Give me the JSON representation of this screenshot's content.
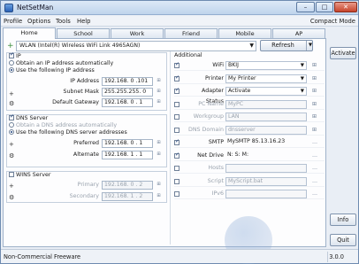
{
  "window": {
    "title": "NetSetMan"
  },
  "menu": {
    "items": [
      "Profile",
      "Options",
      "Tools",
      "Help"
    ],
    "compact_mode": "Compact Mode"
  },
  "tabs": [
    "Home",
    "School",
    "Work",
    "Friend",
    "Mobile",
    "AP"
  ],
  "adapter": {
    "value": "WLAN (Intel(R) Wireless WiFi Link 4965AGN)",
    "refresh_label": "Refresh"
  },
  "ip": {
    "group_label": "IP",
    "option_auto": "Obtain an IP address automatically",
    "option_manual": "Use the following IP address",
    "ip_label": "IP Address",
    "ip_value": "192.168. 0 .101",
    "mask_label": "Subnet Mask",
    "mask_value": "255.255.255. 0",
    "gateway_label": "Default Gateway",
    "gateway_value": "192.168. 0 . 1"
  },
  "dns": {
    "group_label": "DNS Server",
    "option_auto": "Obtain a DNS address automatically",
    "option_manual": "Use the following DNS server addresses",
    "preferred_label": "Preferred",
    "preferred_value": "192.168. 0 . 1",
    "alternate_label": "Alternate",
    "alternate_value": "192.168. 1 . 1"
  },
  "wins": {
    "group_label": "WINS Server",
    "primary_label": "Primary",
    "primary_value": "192.168. 0 . 2",
    "secondary_label": "Secondary",
    "secondary_value": "192.168. 1 . 2"
  },
  "additional": {
    "label": "Additional",
    "rows": [
      {
        "label": "WiFi",
        "value": "BKIJ",
        "checked": true,
        "enabled": true
      },
      {
        "label": "Printer",
        "value": "My Printer",
        "checked": true,
        "enabled": true
      },
      {
        "label": "Adapter Status",
        "value": "Activate",
        "checked": true,
        "enabled": true
      },
      {
        "label": "PC Name",
        "value": "MyPC",
        "checked": false,
        "enabled": false
      },
      {
        "label": "Workgroup",
        "value": "LAN",
        "checked": false,
        "enabled": false
      },
      {
        "label": "DNS Domain",
        "value": "dnsserver",
        "checked": false,
        "enabled": false
      },
      {
        "label": "SMTP",
        "value": "MySMTP 85.13.16.23",
        "checked": true,
        "enabled": true
      },
      {
        "label": "Net Drive",
        "value": "N: S: M:",
        "checked": true,
        "enabled": true
      },
      {
        "label": "Hosts",
        "value": "",
        "checked": false,
        "enabled": false
      },
      {
        "label": "Script",
        "value": "MyScript.bat",
        "checked": false,
        "enabled": false
      },
      {
        "label": "IPv6",
        "value": "",
        "checked": false,
        "enabled": false
      }
    ]
  },
  "buttons": {
    "activate": "Activate",
    "info": "Info",
    "quit": "Quit"
  },
  "status": {
    "text": "Non-Commercial Freeware",
    "version": "3.0.0"
  },
  "colors": {
    "accent": "#2a62b8",
    "window_bg": "#e9eef5",
    "panel_bg": "#fdfdfe"
  }
}
